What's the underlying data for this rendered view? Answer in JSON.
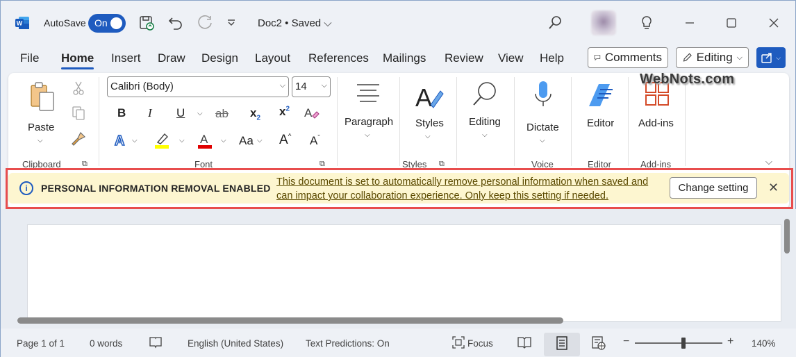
{
  "titlebar": {
    "autosave_label": "AutoSave",
    "autosave_state": "On",
    "doc_title": "Doc2 • Saved ⌵"
  },
  "tabs": [
    "File",
    "Home",
    "Insert",
    "Draw",
    "Design",
    "Layout",
    "References",
    "Mailings",
    "Review",
    "View",
    "Help"
  ],
  "header_buttons": {
    "comments": "Comments",
    "editing": "Editing"
  },
  "ribbon": {
    "clipboard": {
      "paste": "Paste",
      "label": "Clipboard"
    },
    "font": {
      "name": "Calibri (Body)",
      "size": "14",
      "label": "Font",
      "case": "Aa"
    },
    "paragraph": {
      "label": "Paragraph"
    },
    "styles": {
      "big": "Styles",
      "label": "Styles"
    },
    "editing": {
      "big": "Editing"
    },
    "voice": {
      "big": "Dictate",
      "label": "Voice"
    },
    "editor": {
      "big": "Editor",
      "label": "Editor"
    },
    "addins": {
      "big": "Add-ins",
      "label": "Add-ins"
    }
  },
  "infobar": {
    "title": "PERSONAL INFORMATION REMOVAL ENABLED",
    "message": "This document is set to automatically remove personal information when saved and can impact your collaboration experience. Only keep this setting if needed.",
    "button": "Change setting"
  },
  "watermark": "WebNots.com",
  "status": {
    "page": "Page 1 of 1",
    "words": "0 words",
    "language": "English (United States)",
    "predictions": "Text Predictions: On",
    "focus": "Focus",
    "zoom": "140%"
  },
  "colors": {
    "accent": "#1e5bbf",
    "infobar_bg": "#fdf6d0",
    "highlight_box": "#e84d4d"
  }
}
